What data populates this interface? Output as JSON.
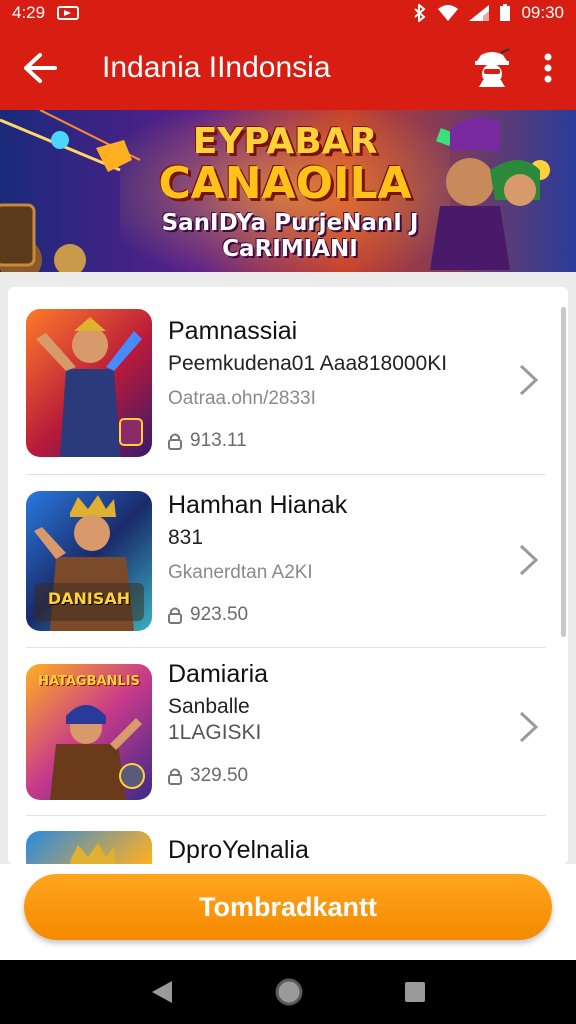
{
  "status_bar": {
    "time": "4:29",
    "clock": "09:30"
  },
  "app_bar": {
    "title": "Indania IIndonsia"
  },
  "banner": {
    "title_line1": "EYPABAR",
    "title_line2": "CANAOILA",
    "subtitle": "SanIDYa PurjeNanI J CaRIMIANI"
  },
  "items": [
    {
      "title": "Pamnassiai",
      "line": "Peemkudena01 Aaa818000KI",
      "sub": "Oatraa.ohn/2833I",
      "price": "913.11"
    },
    {
      "title": "Hamhan Hianak",
      "line": "831",
      "sub": "Gkanerdtan A2KI",
      "price": "923.50"
    },
    {
      "title": "Damiaria",
      "line": "Sanballe",
      "sub": "1LAGISKI",
      "price": "329.50"
    },
    {
      "title": "DproYelnalia",
      "line": "",
      "sub": "",
      "price": ""
    }
  ],
  "thumb_labels": {
    "item2": "DANISAH",
    "item3": "HATAGBANLIS"
  },
  "cta": {
    "label": "Tombradkantt"
  },
  "colors": {
    "header": "#d81e12",
    "accent": "#f58a00"
  },
  "icons": {
    "back": "arrow-left-icon",
    "profile": "spy-avatar-icon",
    "more": "more-vertical-icon",
    "chevron": "chevron-right-icon",
    "price": "lock-icon"
  }
}
